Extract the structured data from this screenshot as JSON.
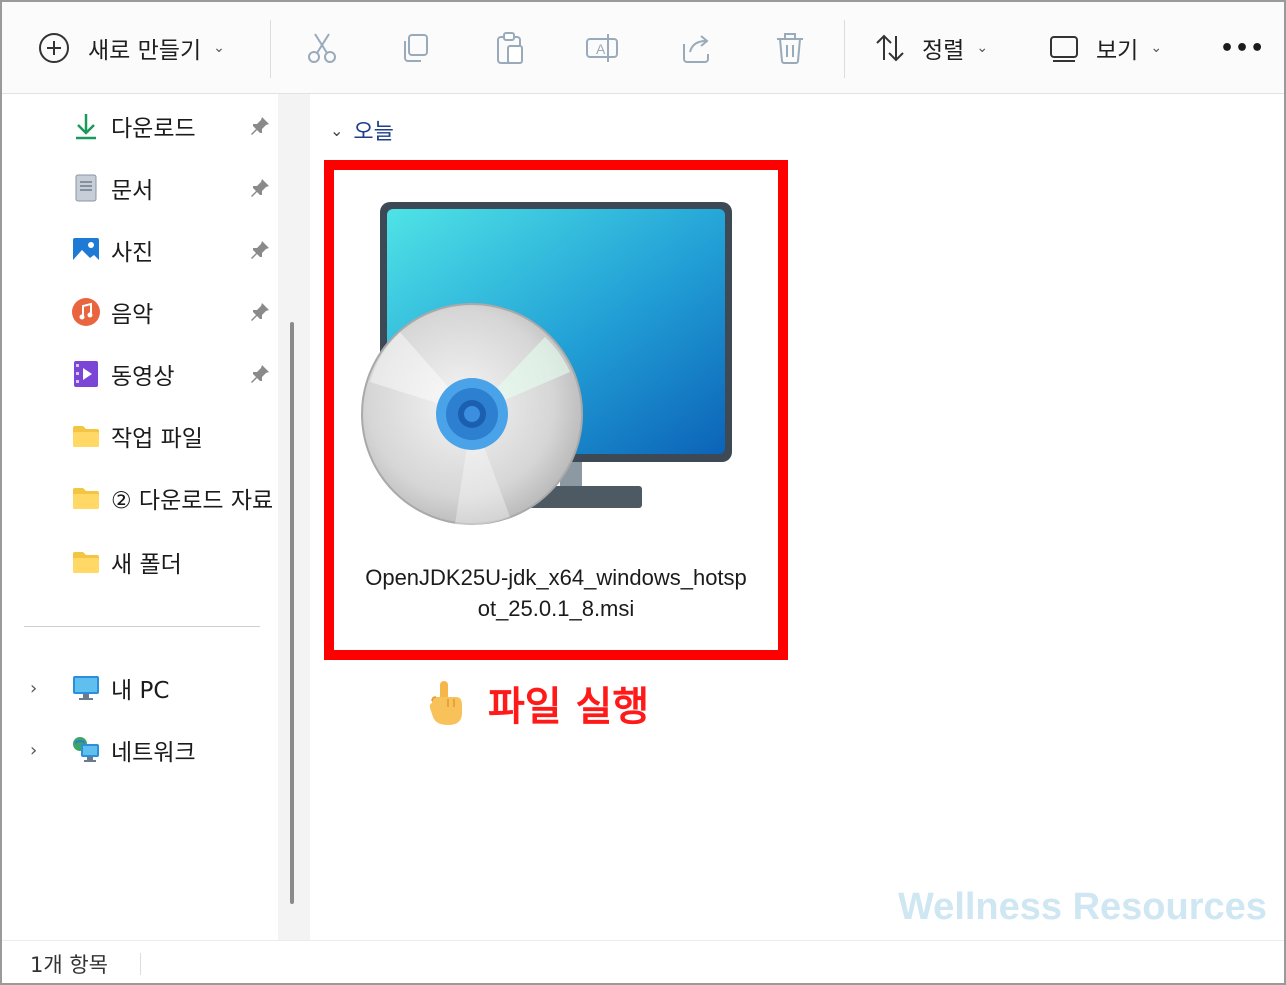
{
  "toolbar": {
    "new_label": "새로 만들기",
    "sort_label": "정렬",
    "view_label": "보기",
    "more_label": "•••"
  },
  "sidebar": {
    "quick_access": [
      {
        "label": "다운로드",
        "icon": "download-icon",
        "pinned": true
      },
      {
        "label": "문서",
        "icon": "document-icon",
        "pinned": true
      },
      {
        "label": "사진",
        "icon": "picture-icon",
        "pinned": true
      },
      {
        "label": "음악",
        "icon": "music-icon",
        "pinned": true
      },
      {
        "label": "동영상",
        "icon": "video-icon",
        "pinned": true
      },
      {
        "label": "작업 파일",
        "icon": "folder-icon",
        "pinned": false
      },
      {
        "label": "② 다운로드 자료",
        "icon": "folder-icon",
        "pinned": false
      },
      {
        "label": "새 폴더",
        "icon": "folder-icon",
        "pinned": false
      }
    ],
    "locations": [
      {
        "label": "내 PC",
        "icon": "pc-icon"
      },
      {
        "label": "네트워크",
        "icon": "network-icon"
      }
    ]
  },
  "main": {
    "group_label": "오늘",
    "file": {
      "name_line1": "OpenJDK25U-jdk_x64_windows_hotsp",
      "name_line2": "ot_25.0.1_8.msi",
      "icon": "msi-installer-icon"
    },
    "annotation": {
      "text": "파일 실행",
      "icon": "pointing-hand-icon"
    },
    "watermark": "Wellness Resources"
  },
  "status": {
    "item_count": "1개 항목"
  },
  "colors": {
    "highlight": "#ff0000",
    "annotation": "#ff1a1a",
    "watermark": "#cfe6f3",
    "group_label": "#1f3f8a"
  }
}
